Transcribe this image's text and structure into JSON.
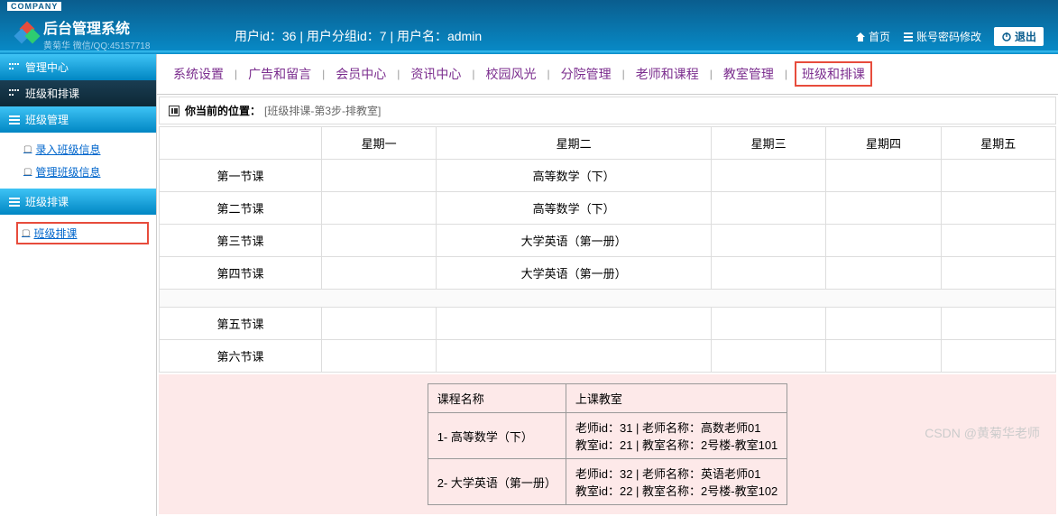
{
  "company_tag": "COMPANY",
  "app_title": "后台管理系统",
  "app_subtitle": "黄菊华 微信/QQ:45157718",
  "header_info": "用户id：36 | 用户分组id：7 | 用户名：admin",
  "header_actions": {
    "home": "首页",
    "account": "账号密码修改",
    "exit": "退出"
  },
  "top_nav": [
    "系统设置",
    "广告和留言",
    "会员中心",
    "资讯中心",
    "校园风光",
    "分院管理",
    "老师和课程",
    "教室管理",
    "班级和排课"
  ],
  "top_nav_highlight_index": 8,
  "sidebar": {
    "center_title": "管理中心",
    "section1": {
      "title": "班级和排课"
    },
    "section2": {
      "title": "班级管理",
      "items": [
        "录入班级信息",
        "管理班级信息"
      ]
    },
    "section3": {
      "title": "班级排课",
      "items": [
        "班级排课"
      ],
      "highlight_index": 0
    }
  },
  "breadcrumb": {
    "label": "你当前的位置：",
    "value": "[班级排课-第3步-排教室]"
  },
  "schedule": {
    "days": [
      "星期一",
      "星期二",
      "星期三",
      "星期四",
      "星期五"
    ],
    "periods_top": [
      "第一节课",
      "第二节课",
      "第三节课",
      "第四节课"
    ],
    "periods_bottom": [
      "第五节课",
      "第六节课"
    ],
    "cells_top": [
      [
        "",
        "高等数学（下）",
        "",
        "",
        ""
      ],
      [
        "",
        "高等数学（下）",
        "",
        "",
        ""
      ],
      [
        "",
        "大学英语（第一册）",
        "",
        "",
        ""
      ],
      [
        "",
        "大学英语（第一册）",
        "",
        "",
        ""
      ]
    ],
    "cells_bottom": [
      [
        "",
        "",
        "",
        "",
        ""
      ],
      [
        "",
        "",
        "",
        "",
        ""
      ]
    ]
  },
  "course_assign": {
    "header_course": "课程名称",
    "header_room": "上课教室",
    "rows": [
      {
        "course": "1- 高等数学（下）",
        "line1": "老师id：31 | 老师名称：高数老师01",
        "line2": "教室id：21 | 教室名称：2号楼-教室101"
      },
      {
        "course": "2- 大学英语（第一册）",
        "line1": "老师id：32 | 老师名称：英语老师01",
        "line2": "教室id：22 | 教室名称：2号楼-教室102"
      }
    ]
  },
  "watermark": "CSDN @黄菊华老师"
}
